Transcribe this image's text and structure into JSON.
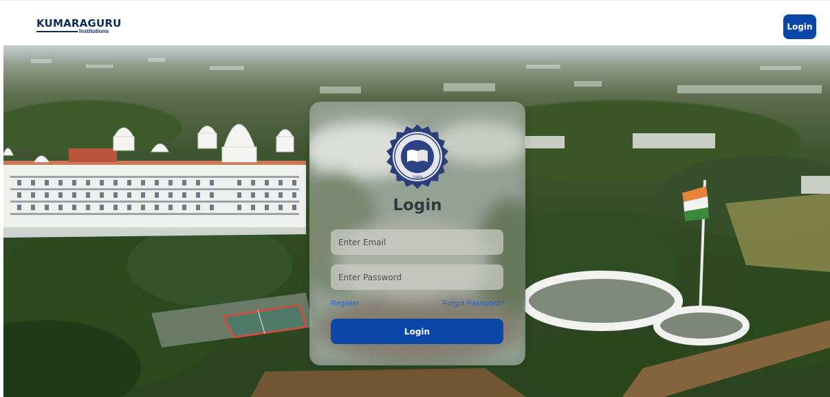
{
  "header": {
    "brand_name": "KUMARAGURU",
    "brand_sub": "Institutions",
    "login_label": "Login"
  },
  "card": {
    "title": "Login",
    "email_placeholder": "Enter Email",
    "password_placeholder": "Enter Password",
    "register_label": "Register",
    "forgot_label": "Forgot Password?",
    "submit_label": "Login",
    "seal_year": "1984"
  },
  "colors": {
    "primary": "#0a47a9",
    "link": "#1d63d8",
    "brand": "#0d2a5c"
  }
}
